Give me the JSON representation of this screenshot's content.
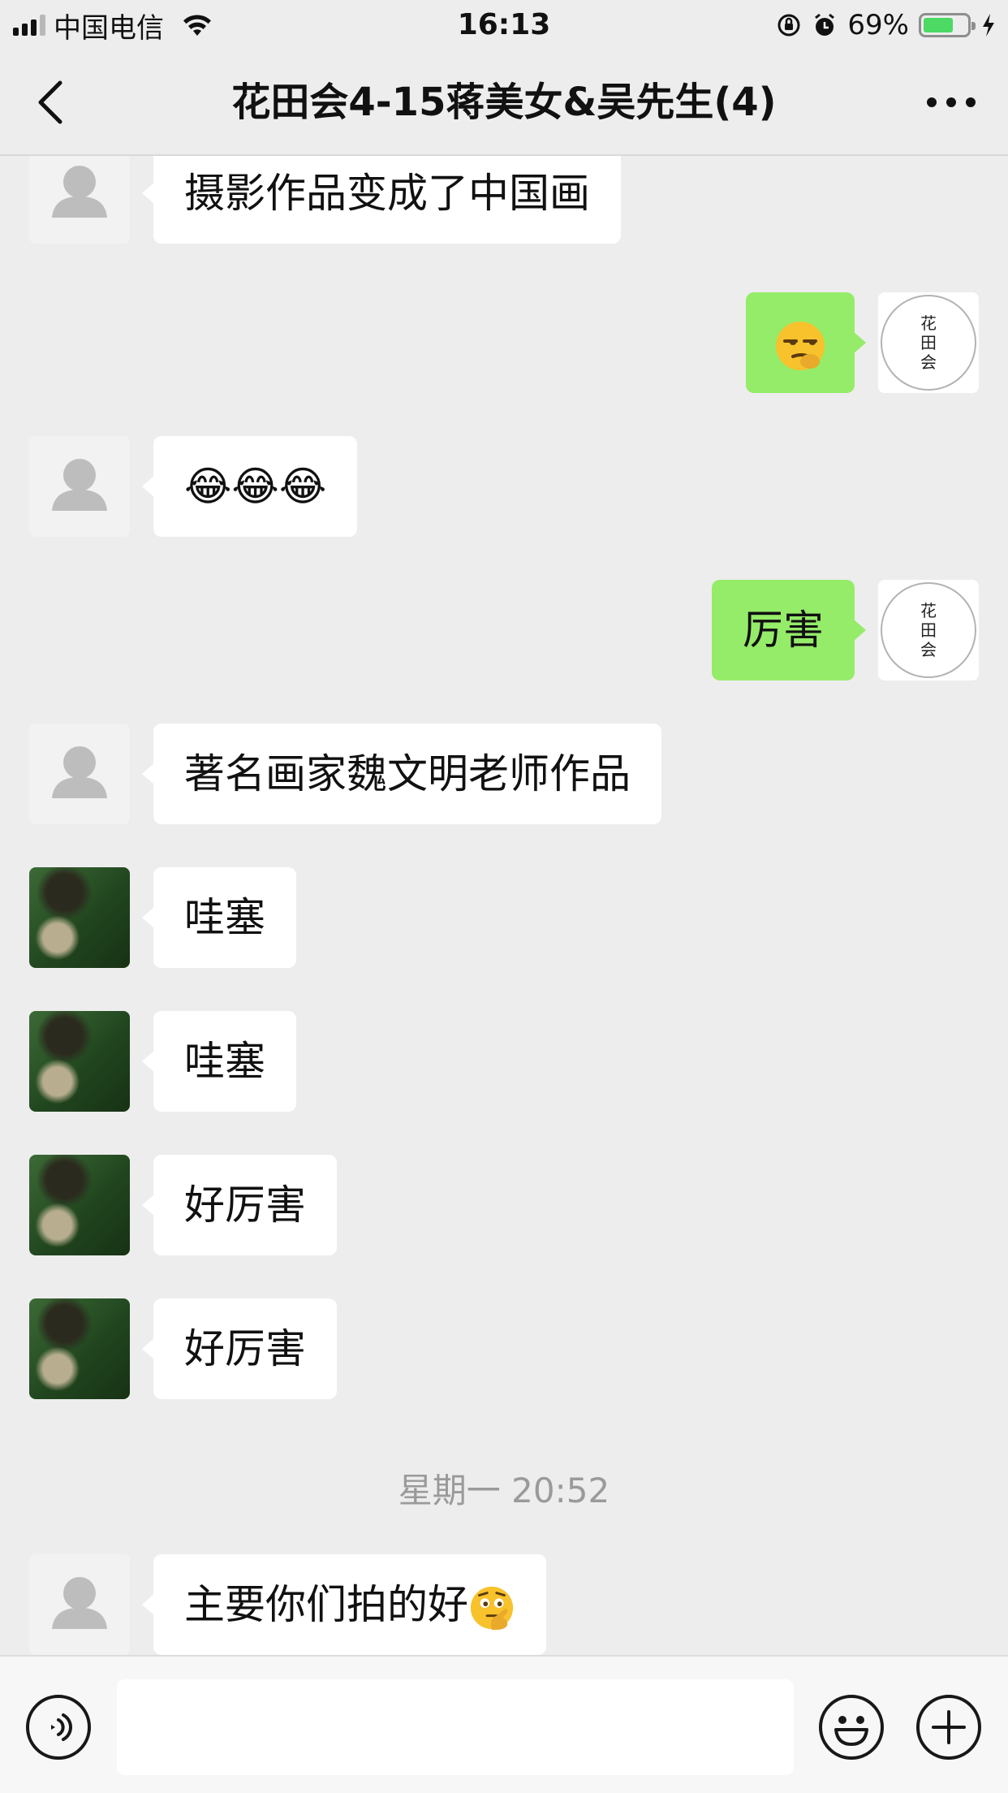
{
  "status_bar": {
    "carrier": "中国电信",
    "time": "16:13",
    "battery_percent_text": "69%",
    "battery_level": 0.69
  },
  "nav": {
    "title": "花田会4-15蒋美女&吴先生(4)"
  },
  "own_avatar_logo_text": "花田会",
  "messages": [
    {
      "side": "left",
      "avatar": "default-person-icon",
      "text": "摄影作品变成了中国画"
    },
    {
      "side": "right",
      "avatar": "logo",
      "emoji": "smirk-emoji"
    },
    {
      "side": "left",
      "avatar": "default-person-icon",
      "text": "😂😂😂"
    },
    {
      "side": "right",
      "avatar": "logo",
      "text": "厉害"
    },
    {
      "side": "left",
      "avatar": "default-person-icon",
      "text": "著名画家魏文明老师作品"
    },
    {
      "side": "left",
      "avatar": "photo",
      "text": "哇塞"
    },
    {
      "side": "left",
      "avatar": "photo",
      "text": "哇塞"
    },
    {
      "side": "left",
      "avatar": "photo",
      "text": "好厉害"
    },
    {
      "side": "left",
      "avatar": "photo",
      "text": "好厉害"
    },
    {
      "side": "left",
      "avatar": "default-person-icon",
      "text": "主要你们拍的好",
      "emoji": "thinking-emoji"
    }
  ],
  "timestamp": "星期一 20:52",
  "input": {
    "value": "",
    "voice_icon": "voice-icon",
    "emoji_icon": "smiley-icon",
    "plus_icon": "plus-icon"
  },
  "colors": {
    "background": "#ededed",
    "sent_bubble": "#95ec69",
    "received_bubble": "#ffffff",
    "timestamp_text": "#9a9a9a",
    "battery_fill": "#4cd964"
  }
}
